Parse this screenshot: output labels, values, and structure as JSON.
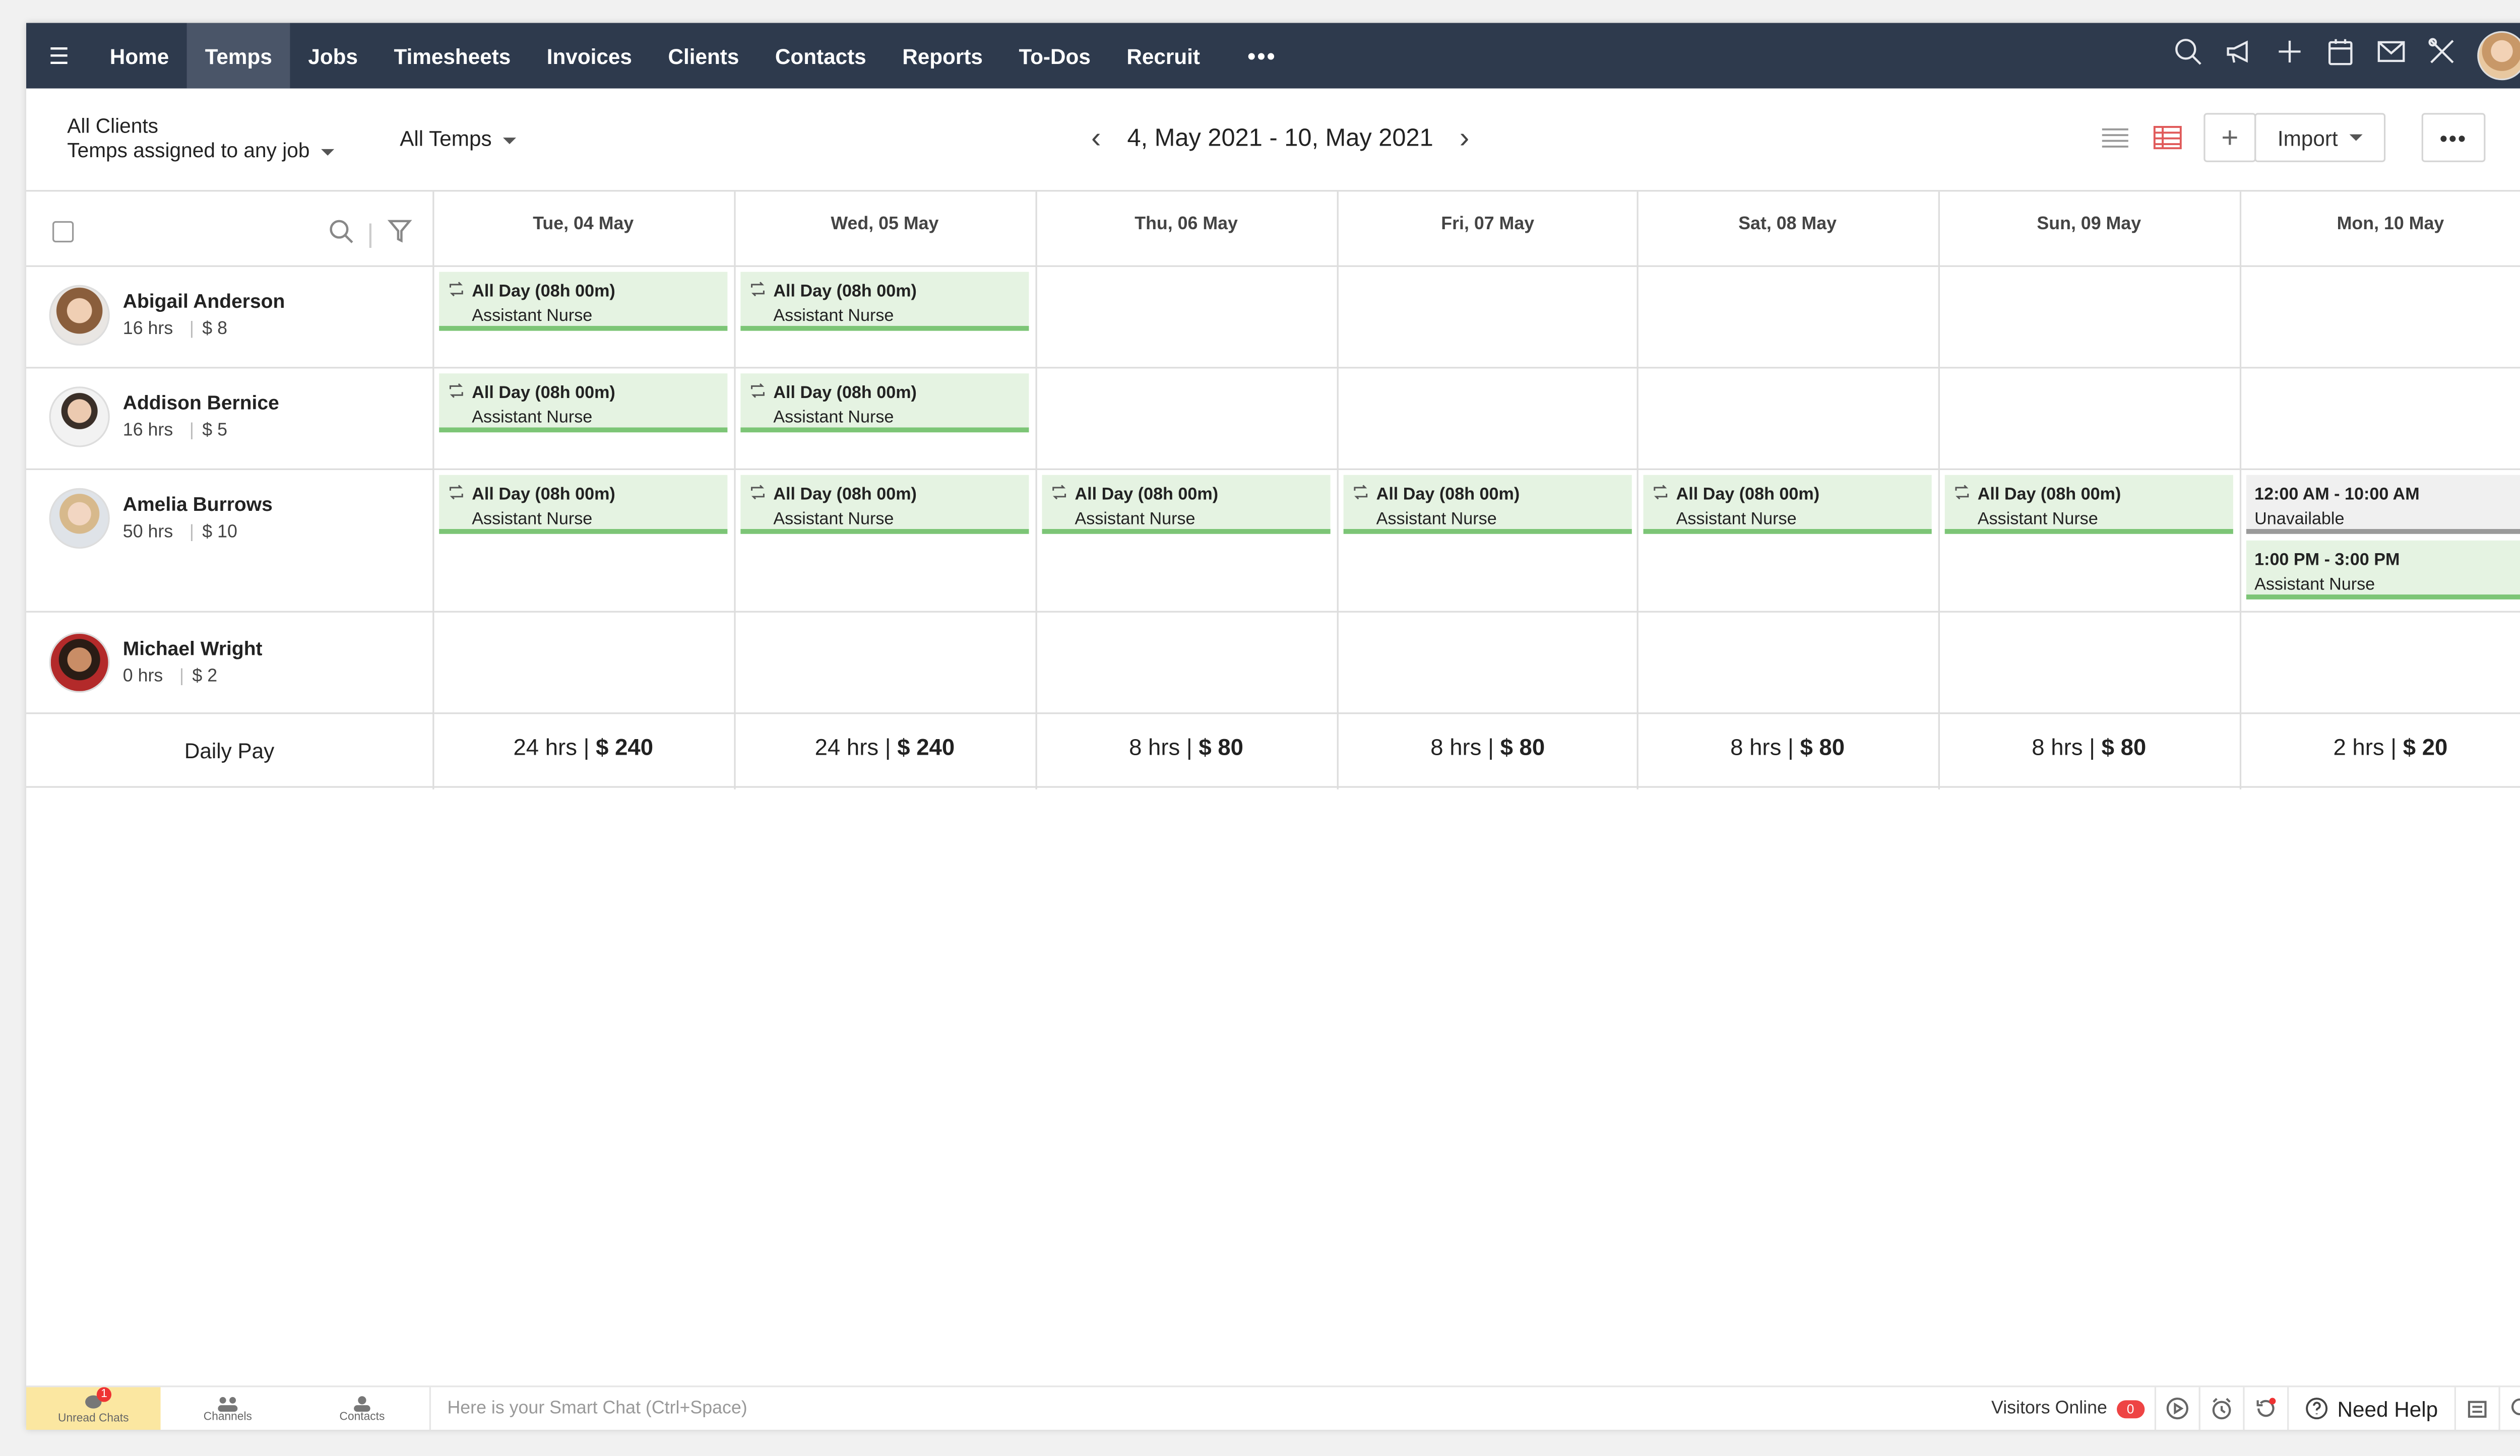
{
  "nav": {
    "tabs": [
      "Home",
      "Temps",
      "Jobs",
      "Timesheets",
      "Invoices",
      "Clients",
      "Contacts",
      "Reports",
      "To-Dos",
      "Recruit"
    ],
    "active": "Temps",
    "more": "•••",
    "icons": [
      "search-icon",
      "announcement-icon",
      "plus-icon",
      "calendar-icon",
      "mail-icon",
      "tools-icon"
    ]
  },
  "toolbar": {
    "clients_filter": "All Clients",
    "clients_sub": "Temps assigned to any job",
    "temps_filter": "All Temps",
    "date_range": "4, May 2021 - 10, May 2021",
    "add": "+",
    "import": "Import",
    "more": "•••"
  },
  "days": [
    "Tue, 04 May",
    "Wed, 05 May",
    "Thu, 06 May",
    "Fri, 07 May",
    "Sat, 08 May",
    "Sun, 09 May",
    "Mon, 10 May"
  ],
  "temps": [
    {
      "name": "Abigail Anderson",
      "hrs": "16 hrs",
      "rate": "$ 8"
    },
    {
      "name": "Addison Bernice",
      "hrs": "16 hrs",
      "rate": "$ 5"
    },
    {
      "name": "Amelia Burrows",
      "hrs": "50 hrs",
      "rate": "$ 10"
    },
    {
      "name": "Michael Wright",
      "hrs": "0 hrs",
      "rate": "$ 2"
    }
  ],
  "shift": {
    "time": "All Day (08h 00m)",
    "role": "Assistant Nurse"
  },
  "special": {
    "unavail_time": "12:00 AM - 10:00 AM",
    "unavail_label": "Unavailable",
    "shift_time": "1:00 PM - 3:00 PM",
    "shift_role": "Assistant Nurse"
  },
  "daily_pay": {
    "label": "Daily Pay",
    "hrs": [
      "24 hrs",
      "24 hrs",
      "8 hrs",
      "8 hrs",
      "8 hrs",
      "8 hrs",
      "2 hrs"
    ],
    "amount": [
      "$ 240",
      "$ 240",
      "$ 80",
      "$ 80",
      "$ 80",
      "$ 80",
      "$ 20"
    ]
  },
  "bottom": {
    "unread": "Unread Chats",
    "unread_count": "1",
    "channels": "Channels",
    "contacts": "Contacts",
    "smart_placeholder": "Here is your Smart Chat (Ctrl+Space)",
    "visitors": "Visitors Online",
    "visitors_count": "0",
    "help": "Need Help"
  },
  "colors": {
    "nav_bg": "#2e3a4d",
    "shift_bg": "#e5f3e2",
    "shift_bar": "#7cc576"
  }
}
